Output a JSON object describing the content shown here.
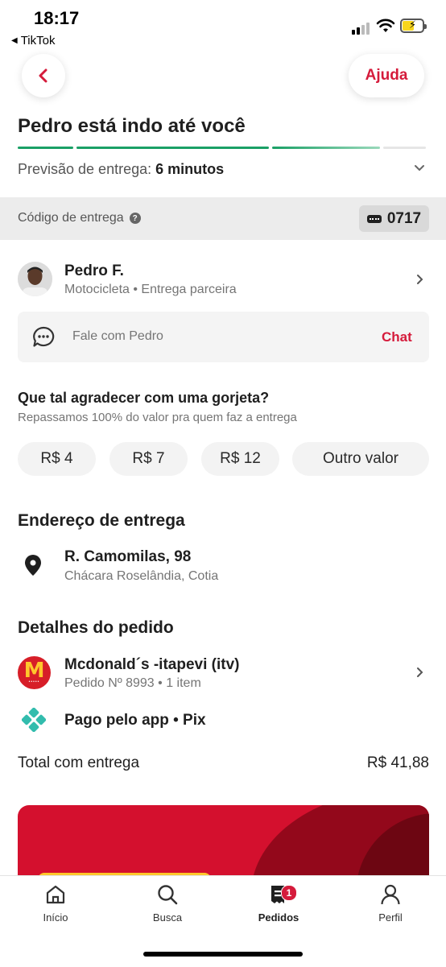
{
  "status_bar": {
    "time": "18:17",
    "back_app": "TikTok"
  },
  "header": {
    "help_label": "Ajuda",
    "title": "Pedro está indo até você"
  },
  "progress": {
    "completed_segments": 3,
    "total_segments": 4,
    "active_color": "#1aa066",
    "done_color": "#7fd0a8",
    "pending_color": "#e6e6e6"
  },
  "eta": {
    "label": "Previsão de entrega:",
    "value": "6 minutos"
  },
  "delivery_code": {
    "label": "Código de entrega",
    "code": "0717"
  },
  "courier": {
    "name": "Pedro F.",
    "subtitle": "Motocicleta • Entrega parceira",
    "chat_placeholder": "Fale com Pedro",
    "chat_action": "Chat"
  },
  "tip": {
    "title": "Que tal agradecer com uma gorjeta?",
    "subtitle": "Repassamos 100% do valor pra quem faz a entrega",
    "options": [
      "R$ 4",
      "R$ 7",
      "R$ 12",
      "Outro valor"
    ]
  },
  "address": {
    "section_title": "Endereço de entrega",
    "street": "R. Camomilas, 98",
    "area": "Chácara Roselândia, Cotia"
  },
  "order": {
    "section_title": "Detalhes do pedido",
    "store_name": "Mcdonald´s -itapevi (itv)",
    "order_info": "Pedido Nº 8993 • 1 item",
    "payment": "Pago pelo app • Pix",
    "total_label": "Total com entrega",
    "total_value": "R$ 41,88"
  },
  "bottom_nav": {
    "items": [
      {
        "label": "Início",
        "icon": "home-icon"
      },
      {
        "label": "Busca",
        "icon": "search-icon"
      },
      {
        "label": "Pedidos",
        "icon": "orders-icon",
        "badge": "1",
        "active": true
      },
      {
        "label": "Perfil",
        "icon": "profile-icon"
      }
    ]
  },
  "colors": {
    "accent": "#d51b3b",
    "pix": "#32bcad",
    "mcdonalds_red": "#d71e28",
    "mcdonalds_yellow": "#ffc72c"
  }
}
